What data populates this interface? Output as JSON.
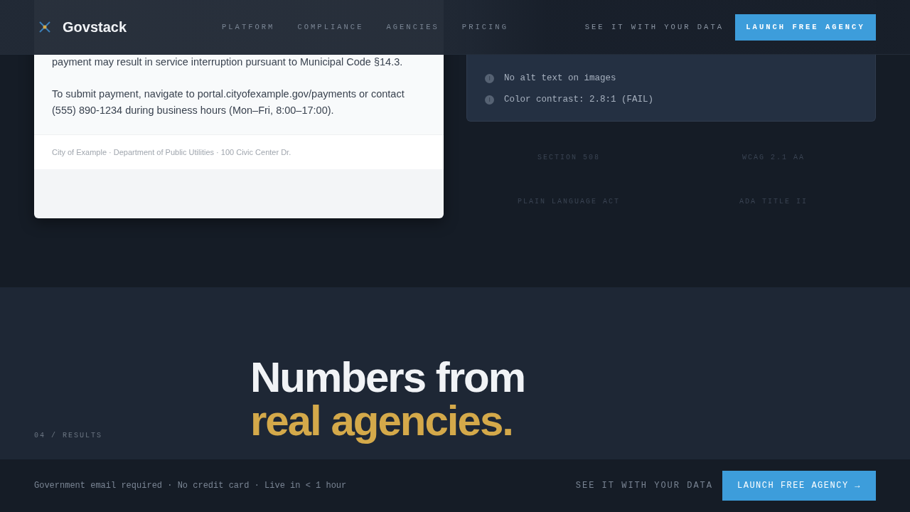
{
  "header": {
    "brand": "Govstack",
    "nav": [
      {
        "label": "PLATFORM"
      },
      {
        "label": "COMPLIANCE"
      },
      {
        "label": "AGENCIES"
      },
      {
        "label": "PRICING"
      }
    ],
    "secondary_link": "SEE IT WITH YOUR DATA",
    "cta": "LAUNCH FREE AGENCY"
  },
  "notice_card": {
    "paragraphs": [
      "payment may result in service interruption pursuant to Municipal Code §14.3.",
      "To submit payment, navigate to portal.cityofexample.gov/payments or contact (555) 890-1234 during business hours (Mon–Fri, 8:00–17:00)."
    ],
    "footer": "City of Example · Department of Public Utilities · 100 Civic Center Dr."
  },
  "issues": [
    "No alt text on images",
    "Color contrast: 2.8:1 (FAIL)"
  ],
  "standards": [
    "SECTION 508",
    "WCAG 2.1 AA",
    "PLAIN LANGUAGE ACT",
    "ADA TITLE II"
  ],
  "results": {
    "eyebrow": "04 / RESULTS",
    "headline": "Numbers from",
    "headline_accent": "real agencies."
  },
  "footer_bar": {
    "note": "Government email required · No credit card · Live in < 1 hour",
    "secondary_link": "SEE IT WITH YOUR DATA",
    "cta": "LAUNCH FREE AGENCY →"
  }
}
